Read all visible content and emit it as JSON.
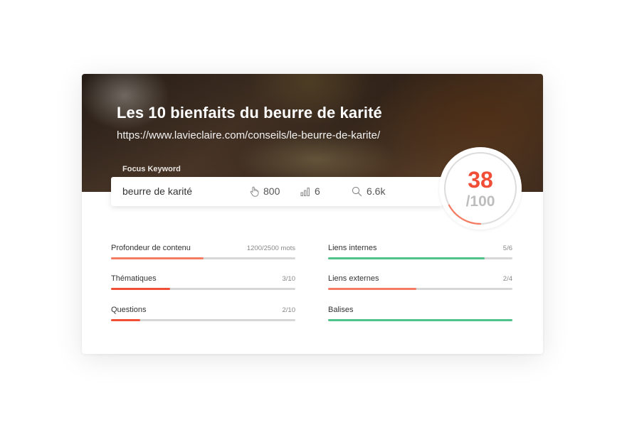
{
  "page": {
    "title": "Les 10 bienfaits du beurre de karité",
    "url": "https://www.lavieclaire.com/conseils/le-beurre-de-karite/"
  },
  "focus": {
    "label": "Focus Keyword",
    "keyword": "beurre de karité",
    "metrics": [
      {
        "icon": "hand-pointer-icon",
        "value": "800"
      },
      {
        "icon": "bar-chart-icon",
        "value": "6"
      },
      {
        "icon": "search-icon",
        "value": "6.6k"
      }
    ]
  },
  "score": {
    "value": "38",
    "max": "/100",
    "fraction": 0.38,
    "color": "#f04e37"
  },
  "colors": {
    "red": "#f04e37",
    "salmon": "#f47c63",
    "green": "#4fc38a",
    "track": "#d7d7d7"
  },
  "criteria": [
    {
      "label": "Profondeur de contenu",
      "value": "1200/2500 mots",
      "fill": 0.5,
      "color": "#f47c63"
    },
    {
      "label": "Liens internes",
      "value": "5/6",
      "fill": 0.85,
      "color": "#4fc38a"
    },
    {
      "label": "Thématiques",
      "value": "3/10",
      "fill": 0.32,
      "color": "#f04e37"
    },
    {
      "label": "Liens externes",
      "value": "2/4",
      "fill": 0.48,
      "color": "#f47c63"
    },
    {
      "label": "Questions",
      "value": "2/10",
      "fill": 0.16,
      "color": "#f04e37"
    },
    {
      "label": "Balises",
      "value": "",
      "fill": 1.0,
      "color": "#4fc38a"
    }
  ]
}
